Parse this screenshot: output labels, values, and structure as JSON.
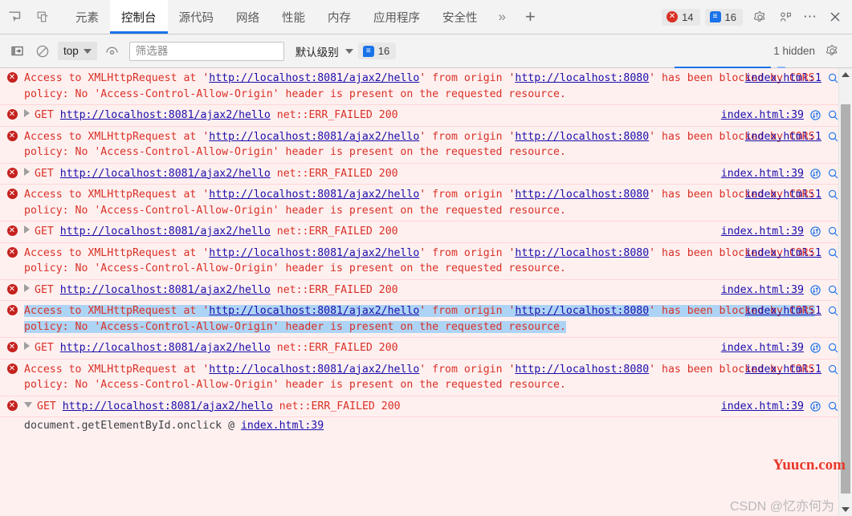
{
  "tabbar": {
    "inspect_icon": "inspect-element-icon",
    "device_icon": "device-toolbar-icon",
    "tabs": [
      {
        "label": "元素",
        "active": false
      },
      {
        "label": "控制台",
        "active": true
      },
      {
        "label": "源代码",
        "active": false
      },
      {
        "label": "网络",
        "active": false
      },
      {
        "label": "性能",
        "active": false
      },
      {
        "label": "内存",
        "active": false
      },
      {
        "label": "应用程序",
        "active": false
      },
      {
        "label": "安全性",
        "active": false
      }
    ],
    "more_tabs": "»",
    "add_tab": "+",
    "error_badge": "14",
    "message_badge": "16",
    "settings_icon": "gear-icon",
    "dock_icon": "dock-side-icon",
    "overflow": "⋯",
    "close": "✕",
    "accent": "#1a73e8",
    "error_color": "#d93025"
  },
  "console_toolbar": {
    "sidebar_toggle": "console-sidebar-toggle-icon",
    "clear_console": "clear-console-icon",
    "context_selected": "top",
    "eye_icon": "live-expression-icon",
    "filter_placeholder": "筛选器",
    "filter_value": "",
    "level_label": "默认级别",
    "message_badge": "16",
    "hidden_label": "1 hidden",
    "settings_icon": "gear-icon"
  },
  "console": {
    "messages": [
      {
        "type": "cors",
        "text_1": "Access to XMLHttpRequest at ",
        "url_1": "http://localhost:8081/ajax2/hello",
        "text_2": " from origin ",
        "url_2": "http://localhost:8080",
        "text_3": " has been blocked by CORS policy: No 'Access-Control-Allow-Origin' header is present on the requested resource.",
        "source": "index.html:1",
        "selected": false
      },
      {
        "type": "get",
        "method": "GET",
        "url": "http://localhost:8081/ajax2/hello",
        "status": "net::ERR_FAILED 200",
        "source": "index.html:39",
        "expanded": false,
        "selected": false
      },
      {
        "type": "cors",
        "text_1": "Access to XMLHttpRequest at ",
        "url_1": "http://localhost:8081/ajax2/hello",
        "text_2": " from origin ",
        "url_2": "http://localhost:8080",
        "text_3": " has been blocked by CORS policy: No 'Access-Control-Allow-Origin' header is present on the requested resource.",
        "source": "index.html:1",
        "selected": false
      },
      {
        "type": "get",
        "method": "GET",
        "url": "http://localhost:8081/ajax2/hello",
        "status": "net::ERR_FAILED 200",
        "source": "index.html:39",
        "expanded": false,
        "selected": false
      },
      {
        "type": "cors",
        "text_1": "Access to XMLHttpRequest at ",
        "url_1": "http://localhost:8081/ajax2/hello",
        "text_2": " from origin ",
        "url_2": "http://localhost:8080",
        "text_3": " has been blocked by CORS policy: No 'Access-Control-Allow-Origin' header is present on the requested resource.",
        "source": "index.html:1",
        "selected": false
      },
      {
        "type": "get",
        "method": "GET",
        "url": "http://localhost:8081/ajax2/hello",
        "status": "net::ERR_FAILED 200",
        "source": "index.html:39",
        "expanded": false,
        "selected": false
      },
      {
        "type": "cors",
        "text_1": "Access to XMLHttpRequest at ",
        "url_1": "http://localhost:8081/ajax2/hello",
        "text_2": " from origin ",
        "url_2": "http://localhost:8080",
        "text_3": " has been blocked by CORS policy: No 'Access-Control-Allow-Origin' header is present on the requested resource.",
        "source": "index.html:1",
        "selected": false
      },
      {
        "type": "get",
        "method": "GET",
        "url": "http://localhost:8081/ajax2/hello",
        "status": "net::ERR_FAILED 200",
        "source": "index.html:39",
        "expanded": false,
        "selected": false
      },
      {
        "type": "cors",
        "text_1": "Access to XMLHttpRequest at ",
        "url_1": "http://localhost:8081/ajax2/hello",
        "text_2": " from origin ",
        "url_2": "http://localhost:8080",
        "text_3": " has been blocked by CORS policy: No 'Access-Control-Allow-Origin' header is present on the requested resource.",
        "source": "index.html:1",
        "selected": true
      },
      {
        "type": "get",
        "method": "GET",
        "url": "http://localhost:8081/ajax2/hello",
        "status": "net::ERR_FAILED 200",
        "source": "index.html:39",
        "expanded": false,
        "selected": false
      },
      {
        "type": "cors",
        "text_1": "Access to XMLHttpRequest at ",
        "url_1": "http://localhost:8081/ajax2/hello",
        "text_2": " from origin ",
        "url_2": "http://localhost:8080",
        "text_3": " has been blocked by CORS policy: No 'Access-Control-Allow-Origin' header is present on the requested resource.",
        "source": "index.html:1",
        "selected": false
      },
      {
        "type": "get",
        "method": "GET",
        "url": "http://localhost:8081/ajax2/hello",
        "status": "net::ERR_FAILED 200",
        "source": "index.html:39",
        "expanded": true,
        "selected": false,
        "stack_text": "document.getElementById.onclick @ ",
        "stack_link": "index.html:39"
      }
    ],
    "link_color": "#1a0dab",
    "error_text_color": "#d93025",
    "error_bg": "#fff0f0",
    "selection_color": "#aed4f5"
  },
  "watermarks": {
    "yuucn": "Yuucn.com",
    "csdn": "CSDN @忆亦何为"
  }
}
